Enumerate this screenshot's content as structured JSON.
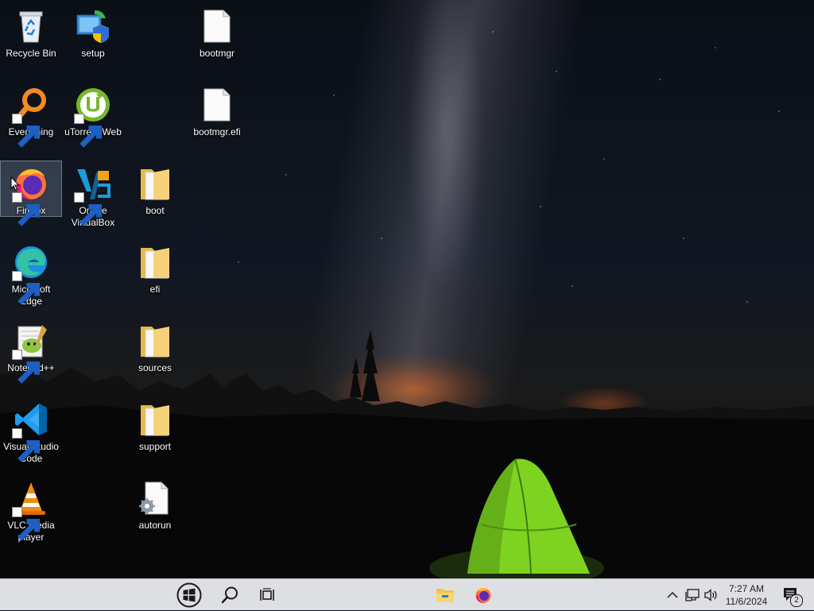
{
  "desktop": {
    "icons": {
      "recycle_bin": "Recycle Bin",
      "setup": "setup",
      "bootmgr": "bootmgr",
      "everything": "Everything",
      "utorrent": "uTorrent Web",
      "bootmgr_efi": "bootmgr.efi",
      "firefox": "Firefox",
      "virtualbox": "Oracle VirtualBox",
      "boot": "boot",
      "edge": "Microsoft Edge",
      "efi": "efi",
      "notepadpp": "Notepad++",
      "sources": "sources",
      "vscode": "Visual Studio Code",
      "support": "support",
      "vlc": "VLC media player",
      "autorun": "autorun"
    },
    "selected_icon": "firefox"
  },
  "taskbar": {
    "clock_time": "7:27 AM",
    "clock_date": "11/6/2024",
    "notification_count": "2"
  },
  "colors": {
    "taskbar_bg": "#dedfe3",
    "folder_yellow": "#f5d27a",
    "tent_green": "#7ed321"
  }
}
